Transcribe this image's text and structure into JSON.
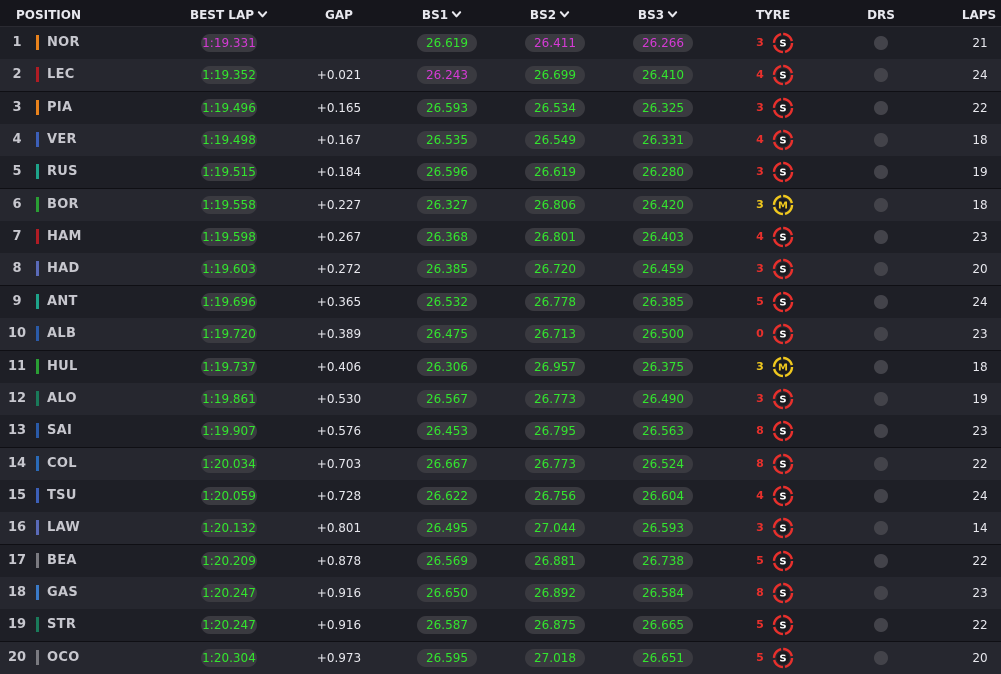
{
  "headers": {
    "position": "POSITION",
    "best_lap": "BEST LAP",
    "gap": "GAP",
    "bs1": "BS1",
    "bs2": "BS2",
    "bs3": "BS3",
    "tyre": "TYRE",
    "drs": "DRS",
    "laps": "LAPS"
  },
  "colors": {
    "green": "#33e62e",
    "purple": "#d63ad6",
    "soft_red": "#e8302c",
    "medium_yellow": "#f0c81e",
    "drs_off": "#43434a"
  },
  "rows": [
    {
      "pos": "1",
      "team_color": "#e8821c",
      "code": "NOR",
      "best": "1:19.331",
      "best_color": "#d63ad6",
      "gap": "",
      "bs1": "26.619",
      "bs1_color": "#33e62e",
      "bs2": "26.411",
      "bs2_color": "#d63ad6",
      "bs3": "26.266",
      "bs3_color": "#d63ad6",
      "tyre_age": "3",
      "tyre": "S",
      "laps": "21"
    },
    {
      "pos": "2",
      "team_color": "#b01c24",
      "code": "LEC",
      "best": "1:19.352",
      "best_color": "#33e62e",
      "gap": "+0.021",
      "bs1": "26.243",
      "bs1_color": "#d63ad6",
      "bs2": "26.699",
      "bs2_color": "#33e62e",
      "bs3": "26.410",
      "bs3_color": "#33e62e",
      "tyre_age": "4",
      "tyre": "S",
      "laps": "24"
    },
    {
      "pos": "3",
      "team_color": "#e8821c",
      "code": "PIA",
      "best": "1:19.496",
      "best_color": "#33e62e",
      "gap": "+0.165",
      "bs1": "26.593",
      "bs1_color": "#33e62e",
      "bs2": "26.534",
      "bs2_color": "#33e62e",
      "bs3": "26.325",
      "bs3_color": "#33e62e",
      "tyre_age": "3",
      "tyre": "S",
      "laps": "22"
    },
    {
      "pos": "4",
      "team_color": "#3c5fb8",
      "code": "VER",
      "best": "1:19.498",
      "best_color": "#33e62e",
      "gap": "+0.167",
      "bs1": "26.535",
      "bs1_color": "#33e62e",
      "bs2": "26.549",
      "bs2_color": "#33e62e",
      "bs3": "26.331",
      "bs3_color": "#33e62e",
      "tyre_age": "4",
      "tyre": "S",
      "laps": "18"
    },
    {
      "pos": "5",
      "team_color": "#1ea38a",
      "code": "RUS",
      "best": "1:19.515",
      "best_color": "#33e62e",
      "gap": "+0.184",
      "bs1": "26.596",
      "bs1_color": "#33e62e",
      "bs2": "26.619",
      "bs2_color": "#33e62e",
      "bs3": "26.280",
      "bs3_color": "#33e62e",
      "tyre_age": "3",
      "tyre": "S",
      "laps": "19"
    },
    {
      "pos": "6",
      "team_color": "#2a9e34",
      "code": "BOR",
      "best": "1:19.558",
      "best_color": "#33e62e",
      "gap": "+0.227",
      "bs1": "26.327",
      "bs1_color": "#33e62e",
      "bs2": "26.806",
      "bs2_color": "#33e62e",
      "bs3": "26.420",
      "bs3_color": "#33e62e",
      "tyre_age": "3",
      "tyre": "M",
      "laps": "18"
    },
    {
      "pos": "7",
      "team_color": "#b01c24",
      "code": "HAM",
      "best": "1:19.598",
      "best_color": "#33e62e",
      "gap": "+0.267",
      "bs1": "26.368",
      "bs1_color": "#33e62e",
      "bs2": "26.801",
      "bs2_color": "#33e62e",
      "bs3": "26.403",
      "bs3_color": "#33e62e",
      "tyre_age": "4",
      "tyre": "S",
      "laps": "23"
    },
    {
      "pos": "8",
      "team_color": "#5a6ab8",
      "code": "HAD",
      "best": "1:19.603",
      "best_color": "#33e62e",
      "gap": "+0.272",
      "bs1": "26.385",
      "bs1_color": "#33e62e",
      "bs2": "26.720",
      "bs2_color": "#33e62e",
      "bs3": "26.459",
      "bs3_color": "#33e62e",
      "tyre_age": "3",
      "tyre": "S",
      "laps": "20"
    },
    {
      "pos": "9",
      "team_color": "#1ea38a",
      "code": "ANT",
      "best": "1:19.696",
      "best_color": "#33e62e",
      "gap": "+0.365",
      "bs1": "26.532",
      "bs1_color": "#33e62e",
      "bs2": "26.778",
      "bs2_color": "#33e62e",
      "bs3": "26.385",
      "bs3_color": "#33e62e",
      "tyre_age": "5",
      "tyre": "S",
      "laps": "24"
    },
    {
      "pos": "10",
      "team_color": "#2a5aa8",
      "code": "ALB",
      "best": "1:19.720",
      "best_color": "#33e62e",
      "gap": "+0.389",
      "bs1": "26.475",
      "bs1_color": "#33e62e",
      "bs2": "26.713",
      "bs2_color": "#33e62e",
      "bs3": "26.500",
      "bs3_color": "#33e62e",
      "tyre_age": "0",
      "tyre": "S",
      "laps": "23"
    },
    {
      "pos": "11",
      "team_color": "#2a9e34",
      "code": "HUL",
      "best": "1:19.737",
      "best_color": "#33e62e",
      "gap": "+0.406",
      "bs1": "26.306",
      "bs1_color": "#33e62e",
      "bs2": "26.957",
      "bs2_color": "#33e62e",
      "bs3": "26.375",
      "bs3_color": "#33e62e",
      "tyre_age": "3",
      "tyre": "M",
      "laps": "18"
    },
    {
      "pos": "12",
      "team_color": "#1a7a5a",
      "code": "ALO",
      "best": "1:19.861",
      "best_color": "#33e62e",
      "gap": "+0.530",
      "bs1": "26.567",
      "bs1_color": "#33e62e",
      "bs2": "26.773",
      "bs2_color": "#33e62e",
      "bs3": "26.490",
      "bs3_color": "#33e62e",
      "tyre_age": "3",
      "tyre": "S",
      "laps": "19"
    },
    {
      "pos": "13",
      "team_color": "#2a5aa8",
      "code": "SAI",
      "best": "1:19.907",
      "best_color": "#33e62e",
      "gap": "+0.576",
      "bs1": "26.453",
      "bs1_color": "#33e62e",
      "bs2": "26.795",
      "bs2_color": "#33e62e",
      "bs3": "26.563",
      "bs3_color": "#33e62e",
      "tyre_age": "8",
      "tyre": "S",
      "laps": "23"
    },
    {
      "pos": "14",
      "team_color": "#2a6ab8",
      "code": "COL",
      "best": "1:20.034",
      "best_color": "#33e62e",
      "gap": "+0.703",
      "bs1": "26.667",
      "bs1_color": "#33e62e",
      "bs2": "26.773",
      "bs2_color": "#33e62e",
      "bs3": "26.524",
      "bs3_color": "#33e62e",
      "tyre_age": "8",
      "tyre": "S",
      "laps": "22"
    },
    {
      "pos": "15",
      "team_color": "#3c5fb8",
      "code": "TSU",
      "best": "1:20.059",
      "best_color": "#33e62e",
      "gap": "+0.728",
      "bs1": "26.622",
      "bs1_color": "#33e62e",
      "bs2": "26.756",
      "bs2_color": "#33e62e",
      "bs3": "26.604",
      "bs3_color": "#33e62e",
      "tyre_age": "4",
      "tyre": "S",
      "laps": "24"
    },
    {
      "pos": "16",
      "team_color": "#5a6ab8",
      "code": "LAW",
      "best": "1:20.132",
      "best_color": "#33e62e",
      "gap": "+0.801",
      "bs1": "26.495",
      "bs1_color": "#33e62e",
      "bs2": "27.044",
      "bs2_color": "#33e62e",
      "bs3": "26.593",
      "bs3_color": "#33e62e",
      "tyre_age": "3",
      "tyre": "S",
      "laps": "14"
    },
    {
      "pos": "17",
      "team_color": "#7a7a80",
      "code": "BEA",
      "best": "1:20.209",
      "best_color": "#33e62e",
      "gap": "+0.878",
      "bs1": "26.569",
      "bs1_color": "#33e62e",
      "bs2": "26.881",
      "bs2_color": "#33e62e",
      "bs3": "26.738",
      "bs3_color": "#33e62e",
      "tyre_age": "5",
      "tyre": "S",
      "laps": "22"
    },
    {
      "pos": "18",
      "team_color": "#3a7ac8",
      "code": "GAS",
      "best": "1:20.247",
      "best_color": "#33e62e",
      "gap": "+0.916",
      "bs1": "26.650",
      "bs1_color": "#33e62e",
      "bs2": "26.892",
      "bs2_color": "#33e62e",
      "bs3": "26.584",
      "bs3_color": "#33e62e",
      "tyre_age": "8",
      "tyre": "S",
      "laps": "23"
    },
    {
      "pos": "19",
      "team_color": "#1a7a5a",
      "code": "STR",
      "best": "1:20.247",
      "best_color": "#33e62e",
      "gap": "+0.916",
      "bs1": "26.587",
      "bs1_color": "#33e62e",
      "bs2": "26.875",
      "bs2_color": "#33e62e",
      "bs3": "26.665",
      "bs3_color": "#33e62e",
      "tyre_age": "5",
      "tyre": "S",
      "laps": "22"
    },
    {
      "pos": "20",
      "team_color": "#7a7a80",
      "code": "OCO",
      "best": "1:20.304",
      "best_color": "#33e62e",
      "gap": "+0.973",
      "bs1": "26.595",
      "bs1_color": "#33e62e",
      "bs2": "27.018",
      "bs2_color": "#33e62e",
      "bs3": "26.651",
      "bs3_color": "#33e62e",
      "tyre_age": "5",
      "tyre": "S",
      "laps": "20"
    }
  ]
}
